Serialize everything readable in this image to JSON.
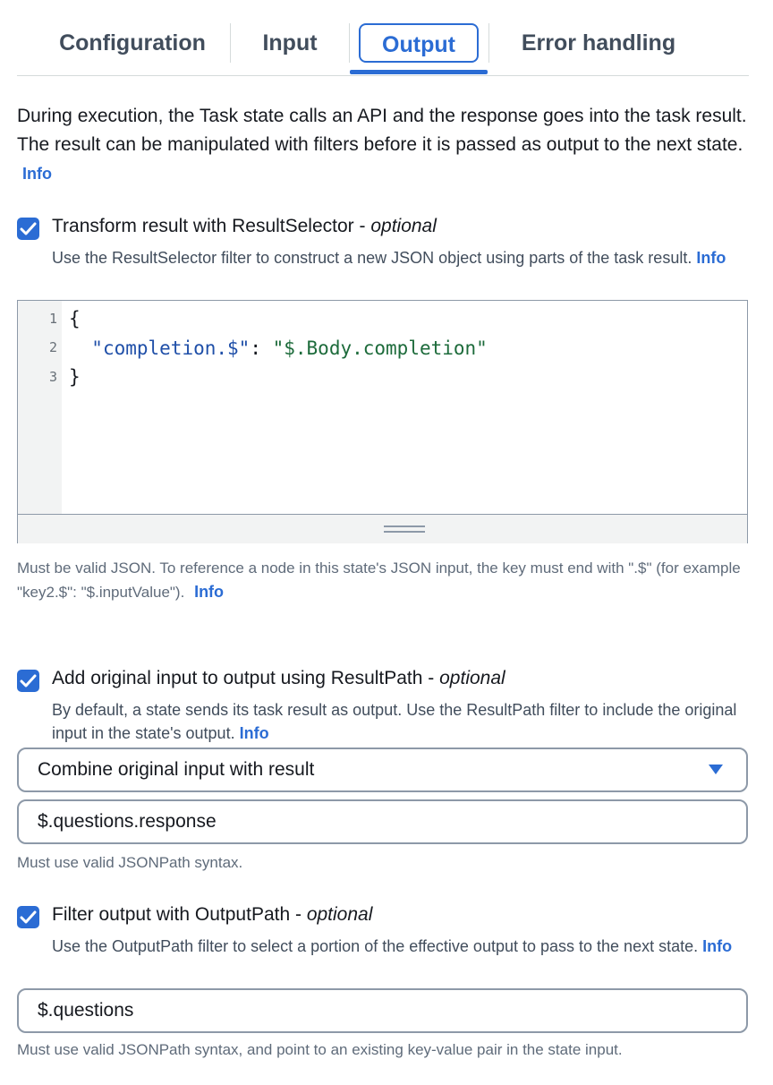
{
  "tabs": [
    {
      "label": "Configuration"
    },
    {
      "label": "Input"
    },
    {
      "label": "Output"
    },
    {
      "label": "Error handling"
    }
  ],
  "description": {
    "text": "During execution, the Task state calls an API and the response goes into the task result. The result can be manipulated with filters before it is passed as output to the next state.",
    "info": "Info"
  },
  "result_selector": {
    "checked": true,
    "title": "Transform result with ResultSelector",
    "optional": "optional",
    "description": "Use the ResultSelector filter to construct a new JSON object using parts of the task result.",
    "info": "Info",
    "code_lines": [
      {
        "num": "1",
        "text": "{"
      },
      {
        "num": "2",
        "key": "\"completion.$\"",
        "sep": ": ",
        "value": "\"$.Body.completion\""
      },
      {
        "num": "3",
        "text": "}"
      }
    ],
    "hint": "Must be valid JSON. To reference a node in this state's JSON input, the key must end with \".$\" (for example \"key2.$\": \"$.inputValue\").",
    "hint_info": "Info"
  },
  "result_path": {
    "checked": true,
    "title": "Add original input to output using ResultPath",
    "optional": "optional",
    "description": "By default, a state sends its task result as output. Use the ResultPath filter to include the original input in the state's output.",
    "info": "Info",
    "select_value": "Combine original input with result",
    "input_value": "$.questions.response",
    "hint": "Must use valid JSONPath syntax."
  },
  "output_path": {
    "checked": true,
    "title": "Filter output with OutputPath",
    "optional": "optional",
    "description": "Use the OutputPath filter to select a portion of the effective output to pass to the next state.",
    "info": "Info",
    "input_value": "$.questions",
    "hint": "Must use valid JSONPath syntax, and point to an existing key-value pair in the state input."
  },
  "colors": {
    "accent": "#2b6cd4",
    "text": "#16191f",
    "muted": "#5f6b7a"
  }
}
